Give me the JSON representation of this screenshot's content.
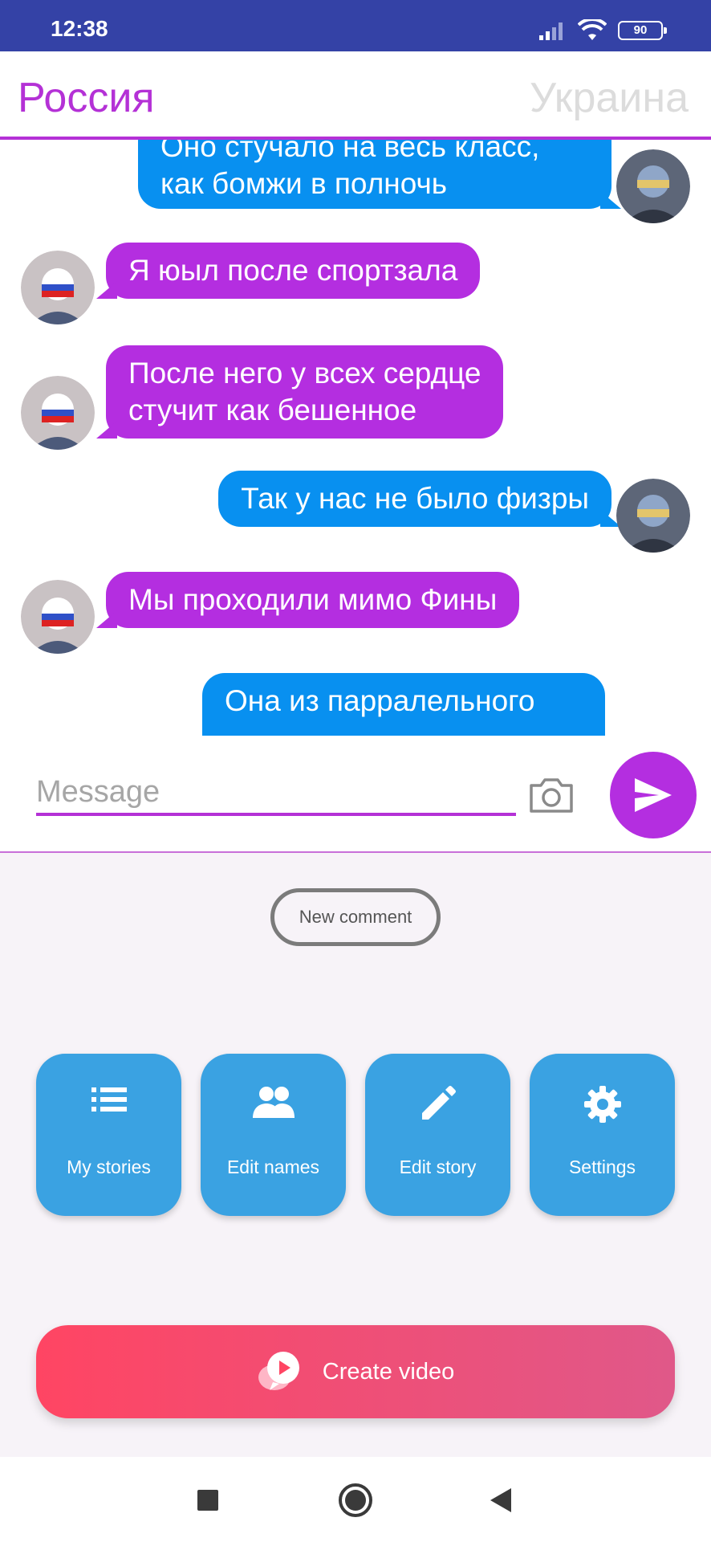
{
  "status_bar": {
    "time": "12:38",
    "battery": "90"
  },
  "header": {
    "left_name": "Россия",
    "right_name": "Украина"
  },
  "messages": [
    {
      "side": "right",
      "text_line1": "Оно стучало на весь класс,",
      "text_line2": "как бомжи в полночь"
    },
    {
      "side": "left",
      "text": "Я юыл после спортзала"
    },
    {
      "side": "left",
      "text_line1": "После него у всех сердце",
      "text_line2": "стучит как бешенное"
    },
    {
      "side": "right",
      "text": "Так у нас не было физры"
    },
    {
      "side": "left",
      "text": "Мы проходили мимо Фины"
    },
    {
      "side": "right",
      "text": "Она из парралельного"
    }
  ],
  "composer": {
    "placeholder": "Message"
  },
  "new_comment_label": "New comment",
  "actions": [
    {
      "label": "My stories",
      "icon": "list-icon"
    },
    {
      "label": "Edit names",
      "icon": "people-icon"
    },
    {
      "label": "Edit story",
      "icon": "pencil-icon"
    },
    {
      "label": "Settings",
      "icon": "gear-icon"
    }
  ],
  "create_video_label": "Create video",
  "colors": {
    "purple": "#b42ee0",
    "blue": "#0890f0",
    "status_bar": "#3442a6",
    "action": "#3aa2e2",
    "create_start": "#ff4563",
    "create_end": "#e05889"
  }
}
